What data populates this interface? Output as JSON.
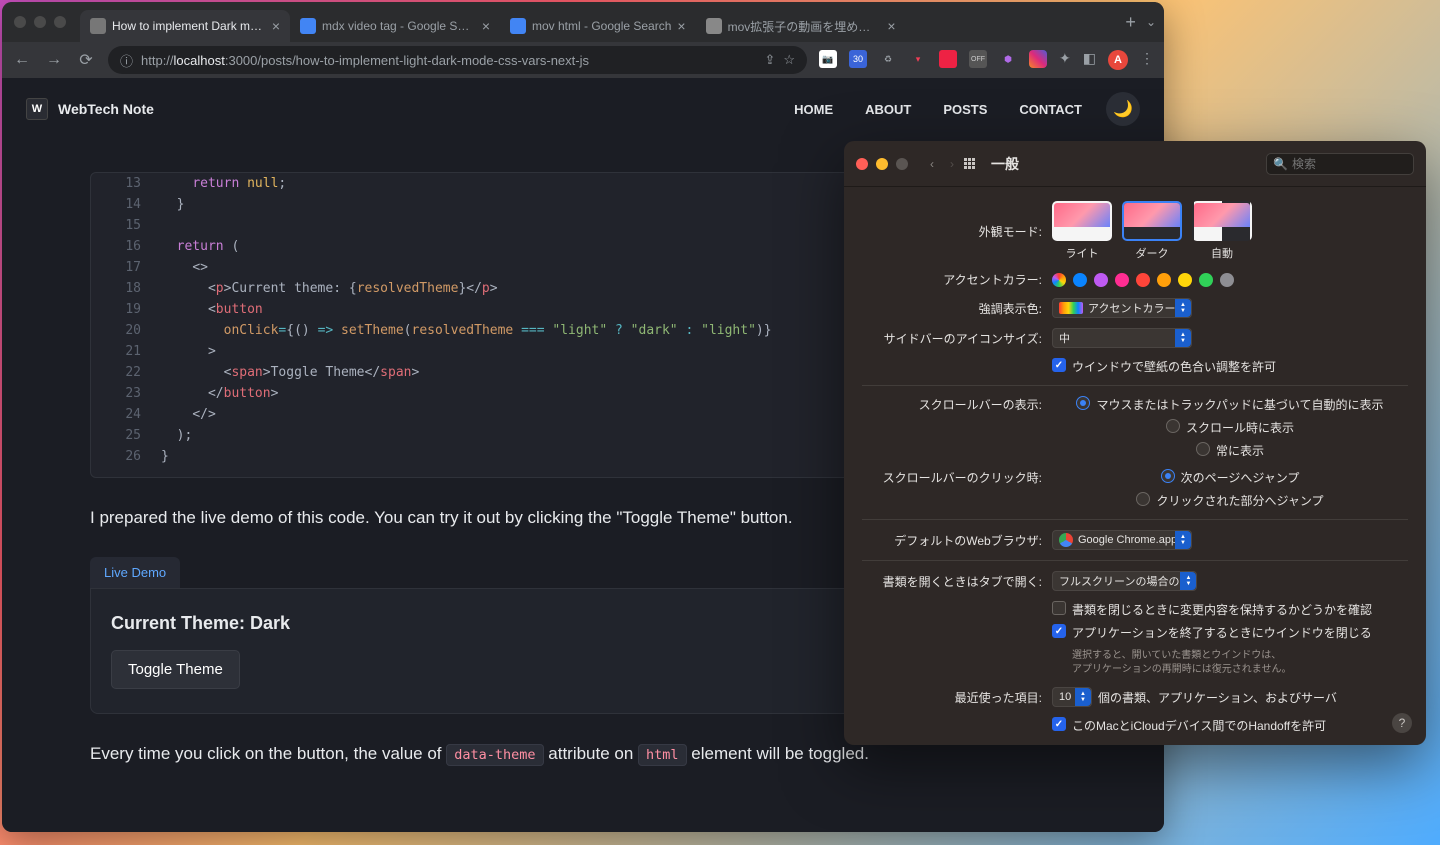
{
  "chrome": {
    "tabs": [
      {
        "label": "How to implement Dark mode w",
        "active": true
      },
      {
        "label": "mdx video tag - Google Search"
      },
      {
        "label": "mov html - Google Search"
      },
      {
        "label": "mov拡張子の動画を埋め込み再生"
      }
    ],
    "url_prefix": "http://",
    "url_host": "localhost",
    "url_path": ":3000/posts/how-to-implement-light-dark-mode-css-vars-next-js",
    "ext_badge": "30",
    "avatar_letter": "A"
  },
  "site": {
    "logo_letter": "W",
    "title": "WebTech Note",
    "nav": [
      "HOME",
      "ABOUT",
      "POSTS",
      "CONTACT"
    ]
  },
  "code_lines": [
    {
      "n": "13",
      "html": "    <span class='tok-k'>return</span> <span class='tok-null'>null</span><span class='tok-punc'>;</span>"
    },
    {
      "n": "14",
      "html": "  <span class='tok-punc'>}</span>"
    },
    {
      "n": "15",
      "html": ""
    },
    {
      "n": "16",
      "html": "  <span class='tok-k'>return</span> <span class='tok-punc'>(</span>"
    },
    {
      "n": "17",
      "html": "    <span class='tok-punc'>&lt;&gt;</span>"
    },
    {
      "n": "18",
      "html": "      <span class='tok-punc'>&lt;</span><span class='tok-tag'>p</span><span class='tok-punc'>&gt;</span><span class='tok-txt'>Current theme: </span><span class='tok-punc'>{</span><span class='tok-attr'>resolvedTheme</span><span class='tok-punc'>}&lt;/</span><span class='tok-tag'>p</span><span class='tok-punc'>&gt;</span>"
    },
    {
      "n": "19",
      "html": "      <span class='tok-punc'>&lt;</span><span class='tok-tag'>button</span>"
    },
    {
      "n": "20",
      "html": "        <span class='tok-attr'>onClick</span><span class='tok-op'>=</span><span class='tok-punc'>{()</span> <span class='tok-op'>=&gt;</span> <span class='tok-attr'>setTheme</span><span class='tok-punc'>(</span><span class='tok-attr'>resolvedTheme</span> <span class='tok-op'>===</span> <span class='tok-str'>&quot;light&quot;</span> <span class='tok-op'>?</span> <span class='tok-str'>&quot;dark&quot;</span> <span class='tok-op'>:</span> <span class='tok-str'>&quot;light&quot;</span><span class='tok-punc'>)}</span>"
    },
    {
      "n": "21",
      "html": "      <span class='tok-punc'>&gt;</span>"
    },
    {
      "n": "22",
      "html": "        <span class='tok-punc'>&lt;</span><span class='tok-tag'>span</span><span class='tok-punc'>&gt;</span><span class='tok-txt'>Toggle Theme</span><span class='tok-punc'>&lt;/</span><span class='tok-tag'>span</span><span class='tok-punc'>&gt;</span>"
    },
    {
      "n": "23",
      "html": "      <span class='tok-punc'>&lt;/</span><span class='tok-tag'>button</span><span class='tok-punc'>&gt;</span>"
    },
    {
      "n": "24",
      "html": "    <span class='tok-punc'>&lt;/&gt;</span>"
    },
    {
      "n": "25",
      "html": "  <span class='tok-punc'>);</span>"
    },
    {
      "n": "26",
      "html": "<span class='tok-punc'>}</span>"
    }
  ],
  "article": {
    "para1": "I prepared the live demo of this code. You can try it out by clicking the \"Toggle Theme\" button.",
    "live_demo_tab": "Live Demo",
    "demo_title": "Current Theme: Dark",
    "demo_button": "Toggle Theme",
    "para2_a": "Every time you click on the button, the value of ",
    "inline1": "data-theme",
    "para2_b": " attribute on ",
    "inline2": "html",
    "para2_c": " element will be toggled."
  },
  "sysprefs": {
    "title": "一般",
    "search_placeholder": "検索",
    "labels": {
      "appearance": "外観モード:",
      "accent": "アクセントカラー:",
      "highlight": "強調表示色:",
      "sidebar_icon": "サイドバーのアイコンサイズ:",
      "wallpaper_tint": "ウインドウで壁紙の色合い調整を許可",
      "scroll_show": "スクロールバーの表示:",
      "scroll_click": "スクロールバーのクリック時:",
      "default_browser": "デフォルトのWebブラウザ:",
      "open_tabs": "書類を開くときはタブで開く:",
      "ask_changes": "書類を閉じるときに変更内容を保持するかどうかを確認",
      "close_windows": "アプリケーションを終了するときにウインドウを閉じる",
      "close_windows_hint": "選択すると、開いていた書類とウインドウは、\nアプリケーションの再開時には復元されません。",
      "recent": "最近使った項目:",
      "recent_suffix": "個の書類、アプリケーション、およびサーバ",
      "handoff": "このMacとiCloudデバイス間でのHandoffを許可"
    },
    "appearance_opts": [
      {
        "label": "ライト"
      },
      {
        "label": "ダーク",
        "selected": true
      },
      {
        "label": "自動"
      }
    ],
    "accent_colors": [
      "#ff3b30",
      "#0a84ff",
      "#bf5af2",
      "#ff2d92",
      "#ff453a",
      "#ff9f0a",
      "#ffd60a",
      "#30d158",
      "#8e8e93"
    ],
    "highlight_value": "アクセントカラー",
    "sidebar_icon_value": "中",
    "scroll_show_opts": [
      {
        "label": "マウスまたはトラックパッドに基づいて自動的に表示",
        "checked": true
      },
      {
        "label": "スクロール時に表示"
      },
      {
        "label": "常に表示"
      }
    ],
    "scroll_click_opts": [
      {
        "label": "次のページへジャンプ",
        "checked": true
      },
      {
        "label": "クリックされた部分へジャンプ"
      }
    ],
    "browser_value": "Google Chrome.app",
    "open_tabs_value": "フルスクリーンの場合のみ",
    "recent_value": "10",
    "checkboxes": {
      "wallpaper_tint": true,
      "ask_changes": false,
      "close_windows": true,
      "handoff": true
    }
  }
}
